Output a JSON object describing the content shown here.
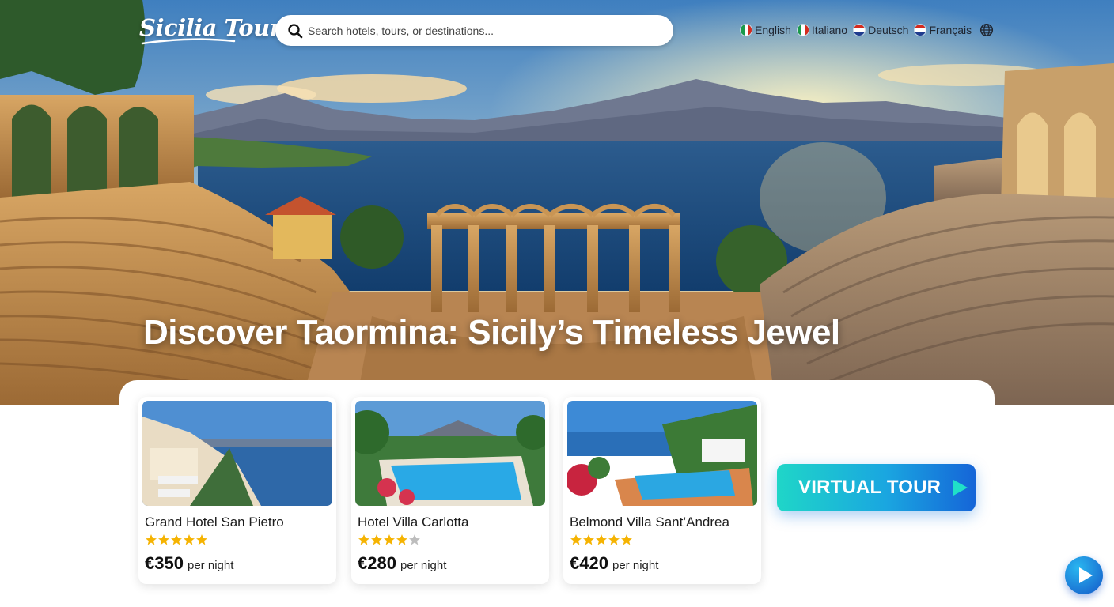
{
  "header": {
    "logo": "Sicilia Tour",
    "search": {
      "placeholder": "Search hotels, tours, or destinations..."
    },
    "languages": [
      {
        "label": "English",
        "flag": "it"
      },
      {
        "label": "Italiano",
        "flag": "it"
      },
      {
        "label": "Deutsch",
        "flag": "fr"
      },
      {
        "label": "Français",
        "flag": "fr"
      }
    ],
    "globe": "globe-icon"
  },
  "hero": {
    "headline": "Discover Taormina: Sicily’s Timeless Jewel"
  },
  "hotels": [
    {
      "name": "Grand Hotel San Pietro",
      "rating": 5,
      "price": "€350",
      "per": "per night"
    },
    {
      "name": "Hotel Villa Carlotta",
      "rating": 4,
      "price": "€280",
      "per": "per night"
    },
    {
      "name": "Belmond Villa Sant’Andrea",
      "rating": 5,
      "price": "€420",
      "per": "per night"
    }
  ],
  "virtual_tour": {
    "label": "VIRTUAL TOUR"
  },
  "colors": {
    "accent_start": "#1fd6c8",
    "accent_end": "#1565d8",
    "star": "#f5b301",
    "star_empty": "#bdbdbd"
  }
}
